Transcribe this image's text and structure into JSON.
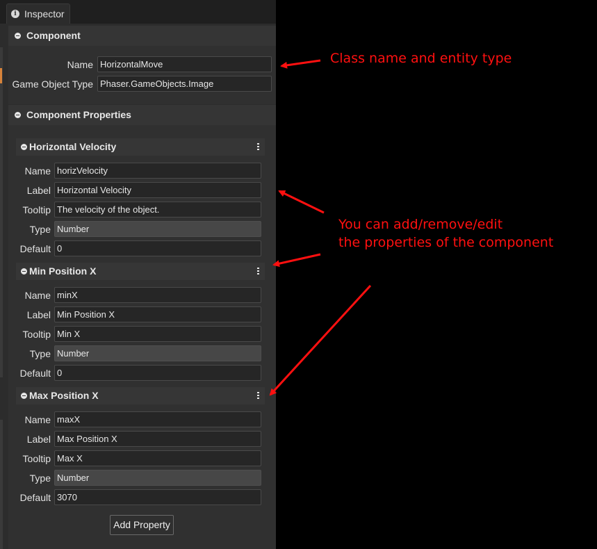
{
  "window": {
    "tab_label": "Inspector",
    "tab_icon": "info-icon"
  },
  "component": {
    "title": "Component",
    "name_label": "Name",
    "name_value": "HorizontalMove",
    "type_label": "Game Object Type",
    "type_value": "Phaser.GameObjects.Image"
  },
  "properties_section": {
    "title": "Component Properties",
    "add_button": "Add Property"
  },
  "properties": [
    {
      "title": "Horizontal Velocity",
      "name_label": "Name",
      "name": "horizVelocity",
      "label_label": "Label",
      "label": "Horizontal Velocity",
      "tooltip_label": "Tooltip",
      "tooltip": "The velocity of the object.",
      "type_label": "Type",
      "type": "Number",
      "default_label": "Default",
      "default": "0"
    },
    {
      "title": "Min Position X",
      "name_label": "Name",
      "name": "minX",
      "label_label": "Label",
      "label": "Min Position X",
      "tooltip_label": "Tooltip",
      "tooltip": "Min X",
      "type_label": "Type",
      "type": "Number",
      "default_label": "Default",
      "default": "0"
    },
    {
      "title": "Max Position X",
      "name_label": "Name",
      "name": "maxX",
      "label_label": "Label",
      "label": "Max Position X",
      "tooltip_label": "Tooltip",
      "tooltip": "Max X",
      "type_label": "Type",
      "type": "Number",
      "default_label": "Default",
      "default": "3070"
    }
  ],
  "annotations": {
    "class_note": "Class name and entity type",
    "props_note_line1": "You can add/remove/edit",
    "props_note_line2": "the properties of the component",
    "color": "#ff1010"
  },
  "colors": {
    "panel_bg": "#2c2c2c",
    "accent": "#d7833a"
  }
}
